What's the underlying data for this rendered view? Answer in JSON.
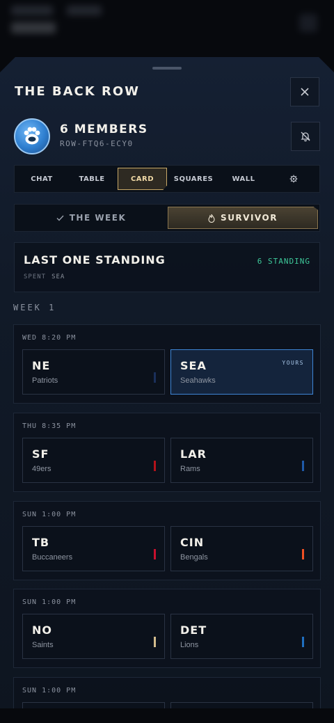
{
  "header": {
    "title": "THE BACK ROW"
  },
  "group": {
    "members": "6 MEMBERS",
    "code": "ROW-FTQ6-ECY0"
  },
  "tabs": [
    {
      "label": "CHAT",
      "active": false
    },
    {
      "label": "TABLE",
      "active": false
    },
    {
      "label": "CARD",
      "active": true
    },
    {
      "label": "SQUARES",
      "active": false
    },
    {
      "label": "WALL",
      "active": false
    },
    {
      "label": "",
      "icon": "gear-icon",
      "active": false
    }
  ],
  "modes": [
    {
      "label": "THE WEEK",
      "icon": "check-icon",
      "active": false
    },
    {
      "label": "SURVIVOR",
      "icon": "flame-icon",
      "active": true
    }
  ],
  "survivor": {
    "title": "LAST ONE STANDING",
    "standing": "6 STANDING",
    "spent_label": "SPENT",
    "spent_teams": "SEA"
  },
  "week_label": "WEEK 1",
  "games": [
    {
      "time": "WED 8:20 PM",
      "away": {
        "abbr": "NE",
        "name": "Patriots",
        "color": "#1a2f5a"
      },
      "home": {
        "abbr": "SEA",
        "name": "Seahawks",
        "color": "#3e86d6",
        "selected": true,
        "badge": "YOURS"
      }
    },
    {
      "time": "THU 8:35 PM",
      "away": {
        "abbr": "SF",
        "name": "49ers",
        "color": "#b3121a"
      },
      "home": {
        "abbr": "LAR",
        "name": "Rams",
        "color": "#1f5aa8"
      }
    },
    {
      "time": "SUN 1:00 PM",
      "away": {
        "abbr": "TB",
        "name": "Buccaneers",
        "color": "#c8102e"
      },
      "home": {
        "abbr": "CIN",
        "name": "Bengals",
        "color": "#f05023"
      }
    },
    {
      "time": "SUN 1:00 PM",
      "away": {
        "abbr": "NO",
        "name": "Saints",
        "color": "#d3bc8d"
      },
      "home": {
        "abbr": "DET",
        "name": "Lions",
        "color": "#1f6fc0"
      }
    },
    {
      "time": "SUN 1:00 PM",
      "away": {
        "abbr": "",
        "name": "",
        "color": ""
      },
      "home": {
        "abbr": "",
        "name": "",
        "color": ""
      }
    }
  ],
  "colors": {
    "accent_gold": "#c8a868",
    "standing_green": "#3ec99a",
    "selected_blue": "#3e86d6"
  }
}
